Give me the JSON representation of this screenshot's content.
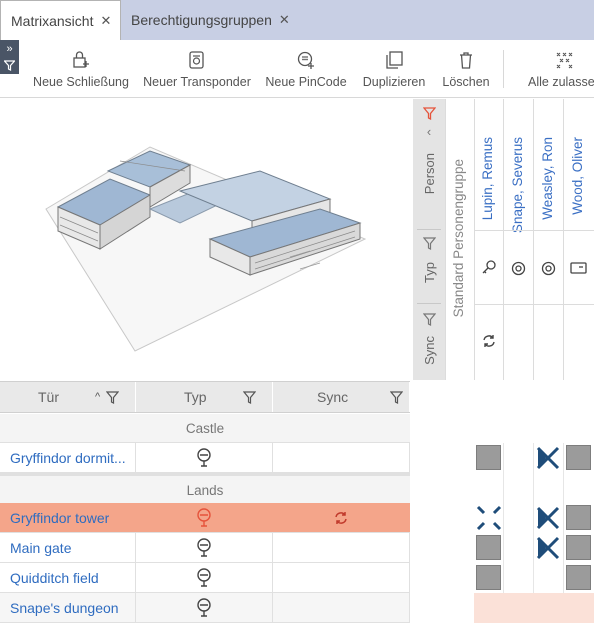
{
  "tabs": [
    {
      "label": "Matrixansicht",
      "active": true
    },
    {
      "label": "Berechtigungsgruppen",
      "active": false
    }
  ],
  "toolbar": {
    "new_lock": "Neue Schließung",
    "new_transponder": "Neuer Transponder",
    "new_pincode": "Neue PinCode",
    "duplicate": "Duplizieren",
    "delete": "Löschen",
    "allow_all": "Alle zulassen"
  },
  "filters": {
    "person": "Person",
    "typ": "Typ",
    "sync": "Sync"
  },
  "persons": {
    "standard_group": "Standard Personengruppe",
    "list": [
      "Lupin, Remus",
      "Snape, Severus",
      "Weasley, Ron",
      "Wood, Oliver"
    ]
  },
  "table": {
    "headers": {
      "door": "Tür",
      "type": "Typ",
      "sync": "Sync"
    },
    "groups": [
      {
        "name": "Castle",
        "rows": [
          {
            "door": "Gryffindor dormit..."
          }
        ]
      },
      {
        "name": "Lands",
        "rows": [
          {
            "door": "Gryffindor tower",
            "selected": true
          },
          {
            "door": "Main gate"
          },
          {
            "door": "Quidditch field"
          },
          {
            "door": "Snape's dungeon"
          }
        ]
      }
    ]
  },
  "colors": {
    "accent_link": "#2f6cc0",
    "selected_row": "#f4a58a",
    "filter_active": "#e5533b",
    "tab_bar": "#c8cfe4"
  }
}
